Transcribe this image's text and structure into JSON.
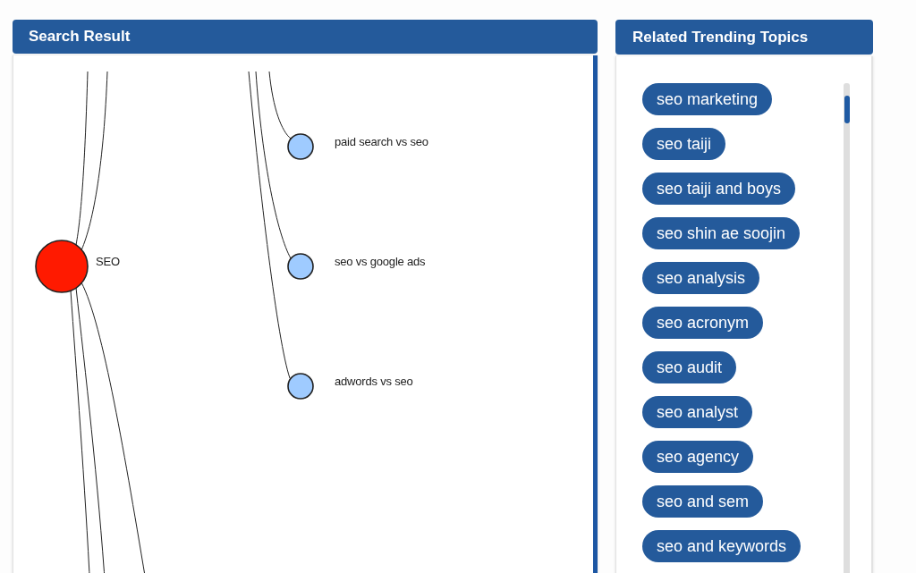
{
  "search_result": {
    "title": "Search Result",
    "graph": {
      "nodes": [
        {
          "label": "SEO",
          "kind": "main"
        },
        {
          "label": "paid search vs seo",
          "kind": "related"
        },
        {
          "label": "seo vs google ads",
          "kind": "related"
        },
        {
          "label": "adwords vs seo",
          "kind": "related"
        }
      ]
    }
  },
  "related_trending_topics": {
    "title": "Related Trending Topics",
    "topics": [
      "seo marketing",
      "seo taiji",
      "seo taiji and boys",
      "seo shin ae soojin",
      "seo analysis",
      "seo acronym",
      "seo audit",
      "seo analyst",
      "seo agency",
      "seo and sem",
      "seo and keywords"
    ]
  }
}
